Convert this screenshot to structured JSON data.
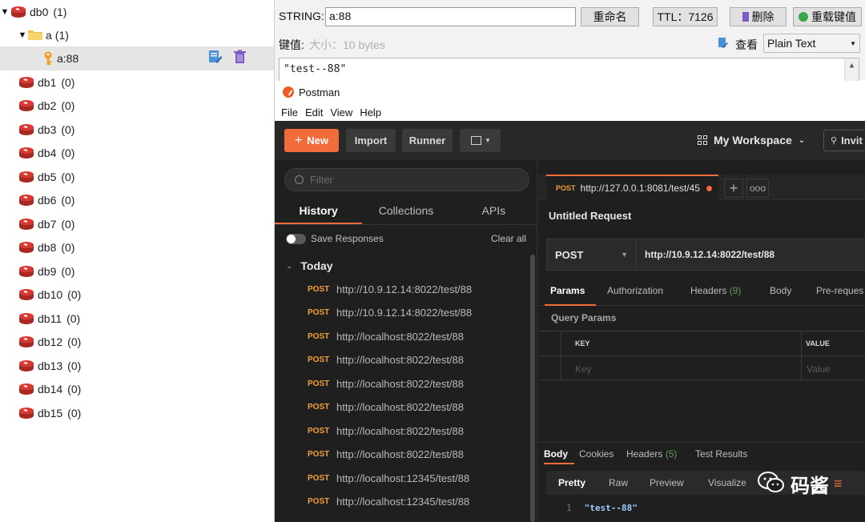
{
  "tree": {
    "db0": {
      "label": "db0",
      "count": "(1)"
    },
    "folder": {
      "label": "a",
      "count": "(1)"
    },
    "key": {
      "label": "a:88"
    },
    "dbs": [
      {
        "label": "db1",
        "count": "(0)"
      },
      {
        "label": "db2",
        "count": "(0)"
      },
      {
        "label": "db3",
        "count": "(0)"
      },
      {
        "label": "db4",
        "count": "(0)"
      },
      {
        "label": "db5",
        "count": "(0)"
      },
      {
        "label": "db6",
        "count": "(0)"
      },
      {
        "label": "db7",
        "count": "(0)"
      },
      {
        "label": "db8",
        "count": "(0)"
      },
      {
        "label": "db9",
        "count": "(0)"
      },
      {
        "label": "db10",
        "count": "(0)"
      },
      {
        "label": "db11",
        "count": "(0)"
      },
      {
        "label": "db12",
        "count": "(0)"
      },
      {
        "label": "db13",
        "count": "(0)"
      },
      {
        "label": "db14",
        "count": "(0)"
      },
      {
        "label": "db15",
        "count": "(0)"
      }
    ]
  },
  "editor": {
    "type_label": "STRING:",
    "key_value": "a:88",
    "rename_label": "重命名",
    "ttl_label": "TTL：7126",
    "delete_label": "删除",
    "reload_label": "重载键值",
    "keyvalue_label": "键值:",
    "size_hint": "大小：10 bytes",
    "view_label": "查看",
    "view_mode": "Plain Text",
    "value_text": "\"test--88\""
  },
  "postman": {
    "title": "Postman",
    "menu": [
      "File",
      "Edit",
      "View",
      "Help"
    ],
    "toolbar": {
      "new_label": "New",
      "import_label": "Import",
      "runner_label": "Runner",
      "workspace_label": "My Workspace",
      "invite_label": "Invit"
    },
    "sidebar": {
      "filter_placeholder": "Filter",
      "tabs": [
        "History",
        "Collections",
        "APIs"
      ],
      "save_responses": "Save Responses",
      "clear_all": "Clear all",
      "group_label": "Today",
      "history": [
        {
          "method": "POST",
          "url": "http://10.9.12.14:8022/test/88"
        },
        {
          "method": "POST",
          "url": "http://10.9.12.14:8022/test/88"
        },
        {
          "method": "POST",
          "url": "http://localhost:8022/test/88"
        },
        {
          "method": "POST",
          "url": "http://localhost:8022/test/88"
        },
        {
          "method": "POST",
          "url": "http://localhost:8022/test/88"
        },
        {
          "method": "POST",
          "url": "http://localhost:8022/test/88"
        },
        {
          "method": "POST",
          "url": "http://localhost:8022/test/88"
        },
        {
          "method": "POST",
          "url": "http://localhost:8022/test/88"
        },
        {
          "method": "POST",
          "url": "http://localhost:12345/test/88"
        },
        {
          "method": "POST",
          "url": "http://localhost:12345/test/88"
        }
      ]
    },
    "main": {
      "tab_method": "POST",
      "tab_url": "http://127.0.0.1:8081/test/45",
      "add_tab": "+",
      "more_tabs": "ooo",
      "request_title": "Untitled Request",
      "method": "POST",
      "url": "http://10.9.12.14:8022/test/88",
      "param_tabs": {
        "params": "Params",
        "authorization": "Authorization",
        "headers": "Headers",
        "headers_count": "(9)",
        "body": "Body",
        "prerequest": "Pre-reques"
      },
      "query_params_label": "Query Params",
      "kv": {
        "key_col": "KEY",
        "value_col": "VALUE",
        "key_ph": "Key",
        "value_ph": "Value"
      },
      "resp_tabs": {
        "body": "Body",
        "cookies": "Cookies",
        "headers": "Headers",
        "headers_count": "(5)",
        "test_results": "Test Results"
      },
      "formats": [
        "Pretty",
        "Raw",
        "Preview",
        "Visualize"
      ],
      "response_line_no": "1",
      "response_text": "\"test--88\""
    }
  },
  "watermark": {
    "text": "码酱"
  },
  "colors": {
    "postman_orange": "#f26b3a",
    "method_orange": "#f2a03c",
    "redis_red": "#c9302c",
    "dark_bg": "#1f1f1f"
  }
}
